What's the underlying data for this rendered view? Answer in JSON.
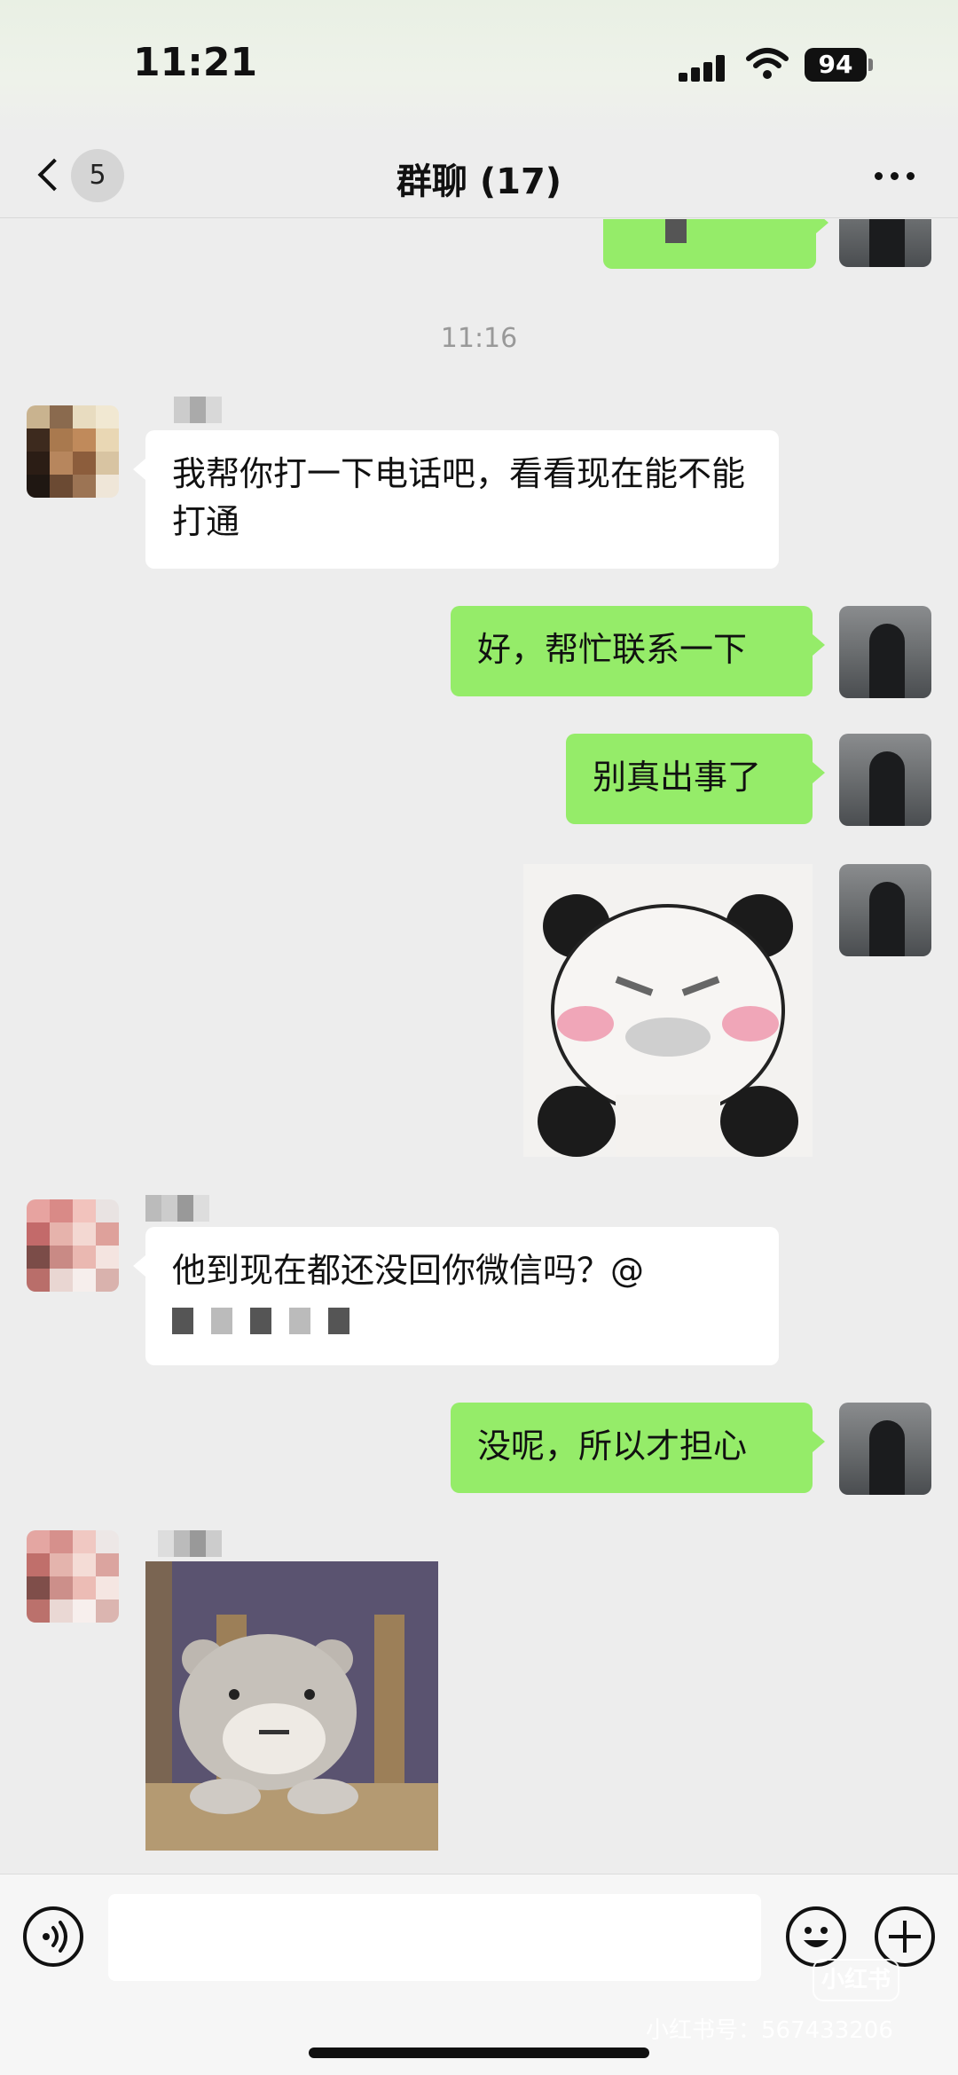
{
  "status_bar": {
    "time": "11:21",
    "battery": "94"
  },
  "nav": {
    "unread_count": "5",
    "title": "群聊 (17)"
  },
  "chat": {
    "timestamp": "11:16",
    "messages": [
      {
        "from": "other",
        "text": "我帮你打一下电话吧，看看现在能不能打通"
      },
      {
        "from": "me",
        "text": "好，帮忙联系一下"
      },
      {
        "from": "me",
        "text": "别真出事了"
      },
      {
        "from": "me",
        "type": "sticker",
        "sticker": "panda-sticker"
      },
      {
        "from": "other",
        "text": "他到现在都还没回你微信吗？@"
      },
      {
        "from": "me",
        "text": "没呢，所以才担心"
      },
      {
        "from": "other",
        "type": "sticker",
        "sticker": "bear-sticker"
      }
    ]
  },
  "watermark": {
    "logo": "小红书",
    "text": "小红书号：567433206"
  },
  "colors": {
    "my_bubble": "#95ec69",
    "their_bubble": "#ffffff",
    "background": "#ededed"
  },
  "icons": {
    "back": "chevron-left-icon",
    "more": "more-icon",
    "voice": "voice-icon",
    "emoji": "emoji-icon",
    "plus": "plus-icon"
  }
}
